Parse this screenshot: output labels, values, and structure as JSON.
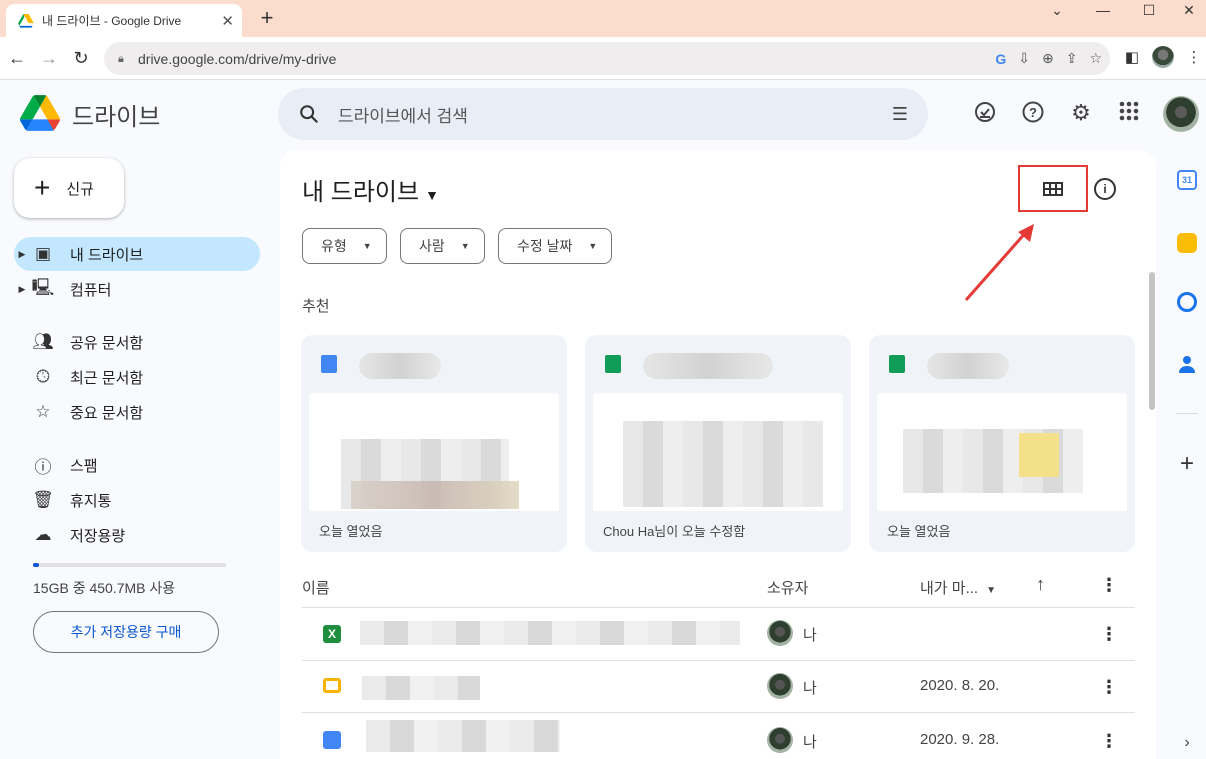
{
  "browser": {
    "tab_title": "내 드라이브 - Google Drive",
    "url": "drive.google.com/drive/my-drive"
  },
  "app": {
    "brand": "드라이브",
    "search_placeholder": "드라이브에서 검색",
    "new_button": "신규"
  },
  "sidebar": {
    "items": [
      {
        "label": "내 드라이브",
        "icon": "my-drive-icon",
        "active": true
      },
      {
        "label": "컴퓨터",
        "icon": "computers-icon"
      },
      {
        "label": "공유 문서함",
        "icon": "shared-people-icon"
      },
      {
        "label": "최근 문서함",
        "icon": "clock-icon"
      },
      {
        "label": "중요 문서함",
        "icon": "star-icon"
      },
      {
        "label": "스팸",
        "icon": "spam-icon"
      },
      {
        "label": "휴지통",
        "icon": "trash-icon"
      },
      {
        "label": "저장용량",
        "icon": "cloud-icon"
      }
    ],
    "storage_text": "15GB 중 450.7MB 사용",
    "storage_used_fraction": 0.03,
    "buy_storage": "추가 저장용량 구매"
  },
  "main": {
    "title": "내 드라이브",
    "filters": [
      "유형",
      "사람",
      "수정 날짜"
    ],
    "suggested_label": "추천",
    "cards": [
      {
        "subtitle": "오늘 열었음",
        "type": "docs"
      },
      {
        "subtitle": "Chou Ha님이 오늘 수정함",
        "type": "sheets"
      },
      {
        "subtitle": "오늘 열었음",
        "type": "sheets"
      }
    ],
    "columns": {
      "name": "이름",
      "owner": "소유자",
      "modified": "내가 마..."
    },
    "rows": [
      {
        "type": "excel",
        "owner": "나",
        "date": ""
      },
      {
        "type": "slides",
        "owner": "나",
        "date": "2020. 8. 20."
      },
      {
        "type": "docs",
        "owner": "나",
        "date": "2020. 9. 28."
      }
    ]
  },
  "colors": {
    "accent": "#0b57d0",
    "active_nav": "#c2e7ff",
    "highlight_box": "#e53935"
  }
}
